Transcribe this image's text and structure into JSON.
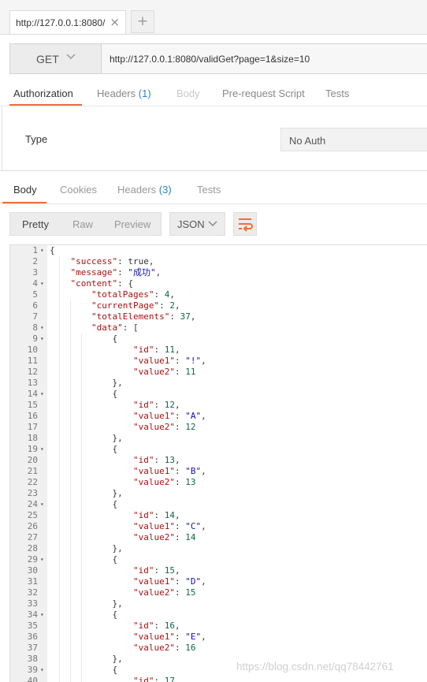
{
  "tab": {
    "title": "http://127.0.0.1:8080/",
    "close_glyph": "×",
    "new_glyph": "+"
  },
  "request": {
    "method": "GET",
    "url": "http://127.0.0.1:8080/validGet?page=1&size=10"
  },
  "request_tabs": {
    "authorization": "Authorization",
    "headers": "Headers",
    "headers_count": "(1)",
    "body": "Body",
    "prerequest": "Pre-request Script",
    "tests": "Tests"
  },
  "auth": {
    "type_label": "Type",
    "type_value": "No Auth"
  },
  "response_tabs": {
    "body": "Body",
    "cookies": "Cookies",
    "headers": "Headers",
    "headers_count": "(3)",
    "tests": "Tests"
  },
  "view": {
    "pretty": "Pretty",
    "raw": "Raw",
    "preview": "Preview",
    "format": "JSON"
  },
  "colors": {
    "accent": "#f26b3a",
    "count": "#2a7fcf"
  },
  "code_lines": [
    {
      "n": "1",
      "fold": true,
      "text": "{"
    },
    {
      "n": "2",
      "text": "    \"success\": true,"
    },
    {
      "n": "3",
      "text": "    \"message\": \"成功\","
    },
    {
      "n": "4",
      "fold": true,
      "text": "    \"content\": {"
    },
    {
      "n": "5",
      "text": "        \"totalPages\": 4,"
    },
    {
      "n": "6",
      "text": "        \"currentPage\": 2,"
    },
    {
      "n": "7",
      "text": "        \"totalElements\": 37,"
    },
    {
      "n": "8",
      "fold": true,
      "text": "        \"data\": ["
    },
    {
      "n": "9",
      "fold": true,
      "text": "            {"
    },
    {
      "n": "10",
      "text": "                \"id\": 11,"
    },
    {
      "n": "11",
      "text": "                \"value1\": \"!\","
    },
    {
      "n": "12",
      "text": "                \"value2\": 11"
    },
    {
      "n": "13",
      "text": "            },"
    },
    {
      "n": "14",
      "fold": true,
      "text": "            {"
    },
    {
      "n": "15",
      "text": "                \"id\": 12,"
    },
    {
      "n": "16",
      "text": "                \"value1\": \"A\","
    },
    {
      "n": "17",
      "text": "                \"value2\": 12"
    },
    {
      "n": "18",
      "text": "            },"
    },
    {
      "n": "19",
      "fold": true,
      "text": "            {"
    },
    {
      "n": "20",
      "text": "                \"id\": 13,"
    },
    {
      "n": "21",
      "text": "                \"value1\": \"B\","
    },
    {
      "n": "22",
      "text": "                \"value2\": 13"
    },
    {
      "n": "23",
      "text": "            },"
    },
    {
      "n": "24",
      "fold": true,
      "text": "            {"
    },
    {
      "n": "25",
      "text": "                \"id\": 14,"
    },
    {
      "n": "26",
      "text": "                \"value1\": \"C\","
    },
    {
      "n": "27",
      "text": "                \"value2\": 14"
    },
    {
      "n": "28",
      "text": "            },"
    },
    {
      "n": "29",
      "fold": true,
      "text": "            {"
    },
    {
      "n": "30",
      "text": "                \"id\": 15,"
    },
    {
      "n": "31",
      "text": "                \"value1\": \"D\","
    },
    {
      "n": "32",
      "text": "                \"value2\": 15"
    },
    {
      "n": "33",
      "text": "            },"
    },
    {
      "n": "34",
      "fold": true,
      "text": "            {"
    },
    {
      "n": "35",
      "text": "                \"id\": 16,"
    },
    {
      "n": "36",
      "text": "                \"value1\": \"E\","
    },
    {
      "n": "37",
      "text": "                \"value2\": 16"
    },
    {
      "n": "38",
      "text": "            },"
    },
    {
      "n": "39",
      "fold": true,
      "text": "            {"
    },
    {
      "n": "40",
      "text": "                \"id\": 17"
    }
  ],
  "watermark": "https://blog.csdn.net/qq78442761"
}
